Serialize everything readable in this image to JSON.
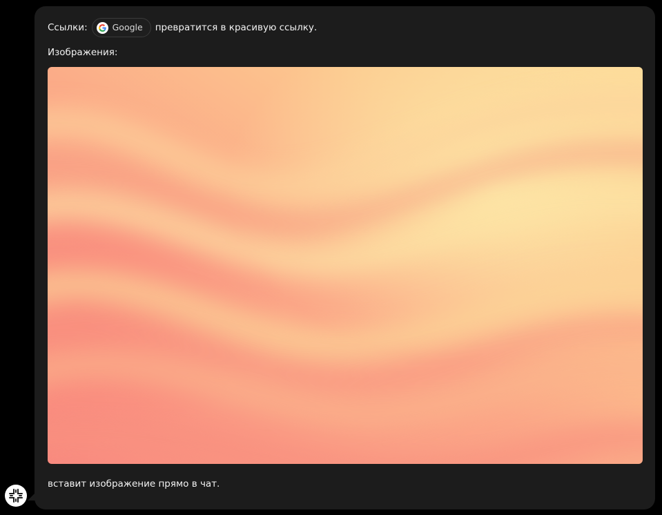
{
  "message": {
    "links_prefix": "Ссылки:",
    "link_chip_label": "Google",
    "links_suffix": "превратится в красивую ссылку.",
    "images_label": "Изображения:",
    "image_caption": "вставит изображение прямо в чат."
  },
  "icons": {
    "link_chip": "google-g-icon",
    "avatar": "bot-logo-icon"
  },
  "colors": {
    "background": "#000000",
    "bubble": "#1c1c1c",
    "text": "#f2f2f2",
    "gradient_warm": "#fba787",
    "gradient_light": "#fce39e",
    "gradient_coral": "#f98d82"
  }
}
